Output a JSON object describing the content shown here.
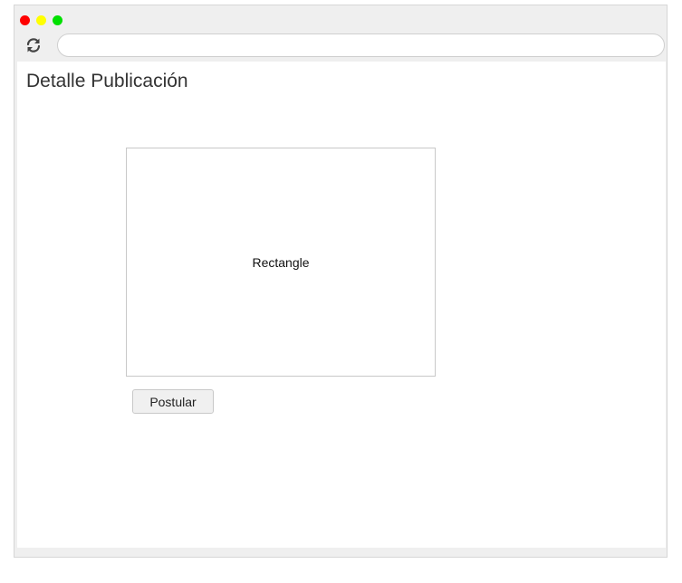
{
  "browser": {
    "address_bar": {
      "value": "",
      "placeholder": ""
    },
    "reload_icon": "reload-icon"
  },
  "page": {
    "title": "Detalle Publicación",
    "image_placeholder_label": "Rectangle",
    "postular_button_label": "Postular"
  },
  "colors": {
    "traffic_red": "#ff0000",
    "traffic_yellow": "#ffff00",
    "traffic_green": "#00e000",
    "chrome_background": "#efefef",
    "content_background": "#ffffff"
  }
}
